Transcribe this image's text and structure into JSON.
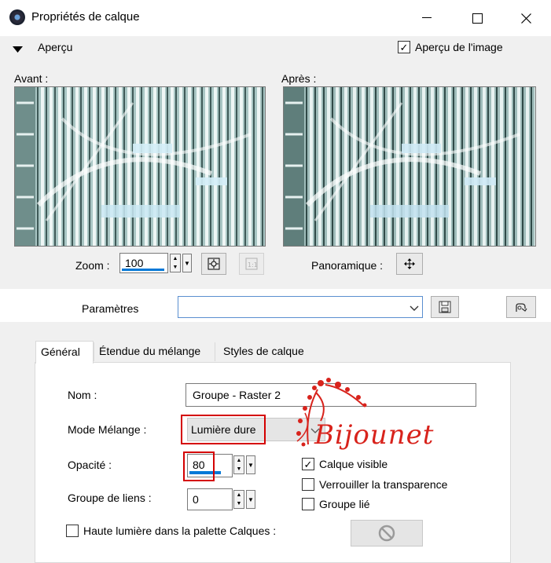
{
  "window": {
    "title": "Propriétés de calque",
    "minimize_icon": "minimize-icon",
    "maximize_icon": "maximize-icon",
    "close_icon": "close-icon"
  },
  "preview_section": {
    "toggle_label": "Aperçu",
    "image_preview_label": "Aperçu de l'image",
    "image_preview_checked": true,
    "before_label": "Avant :",
    "after_label": "Après :",
    "zoom_label": "Zoom :",
    "zoom_value": "100",
    "pan_label": "Panoramique :"
  },
  "params": {
    "label": "Paramètres",
    "value": ""
  },
  "tabs": [
    {
      "label": "Général",
      "active": true
    },
    {
      "label": "Étendue du mélange",
      "active": false
    },
    {
      "label": "Styles de calque",
      "active": false
    }
  ],
  "general": {
    "name_label": "Nom :",
    "name_value": "Groupe - Raster 2",
    "blend_label": "Mode Mélange :",
    "blend_value": "Lumière dure",
    "opacity_label": "Opacité :",
    "opacity_value": "80",
    "opacity_level": 0.8,
    "link_group_label": "Groupe de liens :",
    "link_group_value": "0",
    "visible_label": "Calque visible",
    "visible_checked": true,
    "lock_transparency_label": "Verrouiller la transparence",
    "lock_transparency_checked": false,
    "linked_group_label": "Groupe lié",
    "linked_group_checked": false,
    "highlight_label": "Haute lumière dans la palette Calques :",
    "highlight_checked": false
  },
  "watermark": {
    "text": "Bijounet"
  },
  "colors": {
    "highlight_red": "#d40000",
    "accent_blue": "#0078d7",
    "watermark_red": "#d8231c"
  }
}
